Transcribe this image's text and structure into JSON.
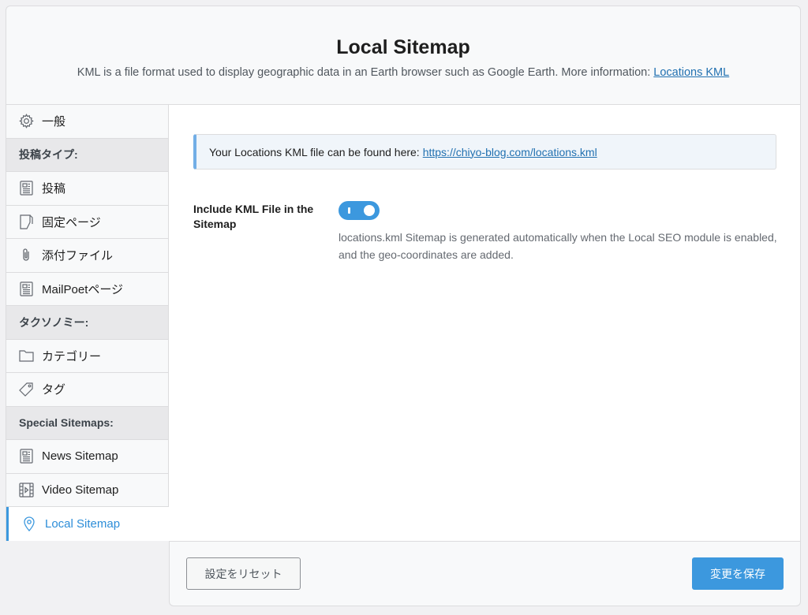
{
  "header": {
    "title": "Local Sitemap",
    "description": "KML is a file format used to display geographic data in an Earth browser such as Google Earth. More information: ",
    "link_label": "Locations KML"
  },
  "sidebar": {
    "general": {
      "label": "一般",
      "icon": "gear-icon"
    },
    "post_types_heading": "投稿タイプ:",
    "post_types": [
      {
        "label": "投稿",
        "icon": "post-icon"
      },
      {
        "label": "固定ページ",
        "icon": "page-icon"
      },
      {
        "label": "添付ファイル",
        "icon": "paperclip-icon"
      },
      {
        "label": "MailPoetページ",
        "icon": "post-icon"
      }
    ],
    "taxonomies_heading": "タクソノミー:",
    "taxonomies": [
      {
        "label": "カテゴリー",
        "icon": "folder-icon"
      },
      {
        "label": "タグ",
        "icon": "tag-icon"
      }
    ],
    "special_heading": "Special Sitemaps:",
    "special": [
      {
        "label": "News Sitemap",
        "icon": "news-icon"
      },
      {
        "label": "Video Sitemap",
        "icon": "video-icon"
      },
      {
        "label": "Local Sitemap",
        "icon": "location-pin-icon",
        "active": true
      }
    ]
  },
  "main": {
    "notice_text": "Your Locations KML file can be found here:",
    "notice_link": "https://chiyo-blog.com/locations.kml",
    "option_label": "Include KML File in the Sitemap",
    "option_enabled": true,
    "option_description": "locations.kml Sitemap is generated automatically when the Local SEO module is enabled, and the geo-coordinates are added."
  },
  "footer": {
    "reset_label": "設定をリセット",
    "save_label": "変更を保存"
  },
  "colors": {
    "accent": "#3c98de",
    "link": "#2271b1",
    "notice_border": "#72aee6"
  }
}
